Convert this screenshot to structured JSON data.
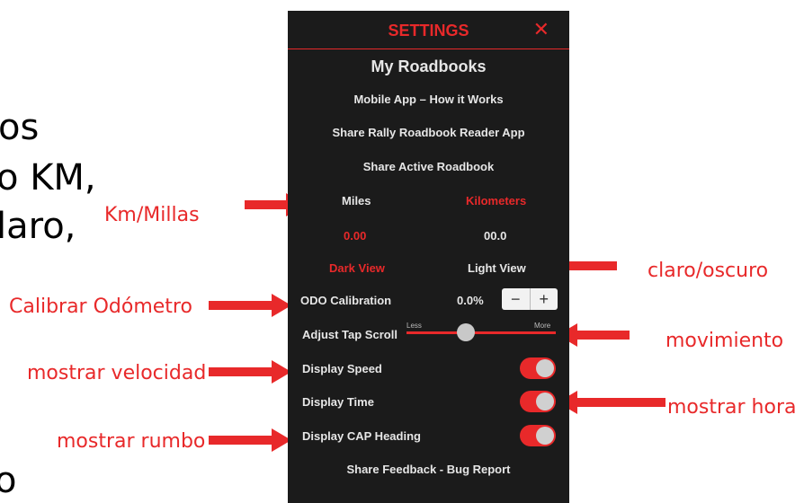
{
  "slide": {
    "lines": [
      "os",
      "o KM,",
      "laro,",
      "o"
    ]
  },
  "annotations": {
    "km_millas": "Km/Millas",
    "calibrar": "Calibrar Odómetro",
    "velocidad": "mostrar velocidad",
    "rumbo": "mostrar rumbo",
    "claro_oscuro": "claro/oscuro",
    "movimiento": "movimiento",
    "hora": "mostrar hora"
  },
  "settings": {
    "title": "SETTINGS",
    "close_symbol": "✕",
    "my_roadbooks": "My Roadbooks",
    "mobile_app": "Mobile App – How it Works",
    "share_app": "Share Rally Roadbook Reader App",
    "share_active": "Share Active Roadbook",
    "units": {
      "miles": "Miles",
      "kilometers": "Kilometers"
    },
    "odo_values": {
      "left": "0.00",
      "right": "00.0"
    },
    "views": {
      "dark": "Dark View",
      "light": "Light View"
    },
    "odo_calibration": {
      "label": "ODO Calibration",
      "value": "0.0%",
      "minus": "−",
      "plus": "+"
    },
    "tap_scroll": {
      "label": "Adjust Tap Scroll",
      "less": "Less",
      "more": "More",
      "level": 0.4
    },
    "display_speed": {
      "label": "Display Speed",
      "on": true
    },
    "display_time": {
      "label": "Display Time",
      "on": true
    },
    "display_cap": {
      "label": "Display CAP Heading",
      "on": true
    },
    "feedback": "Share Feedback - Bug Report"
  },
  "colors": {
    "accent": "#e8292a",
    "panel_bg": "#1b1b1b"
  }
}
